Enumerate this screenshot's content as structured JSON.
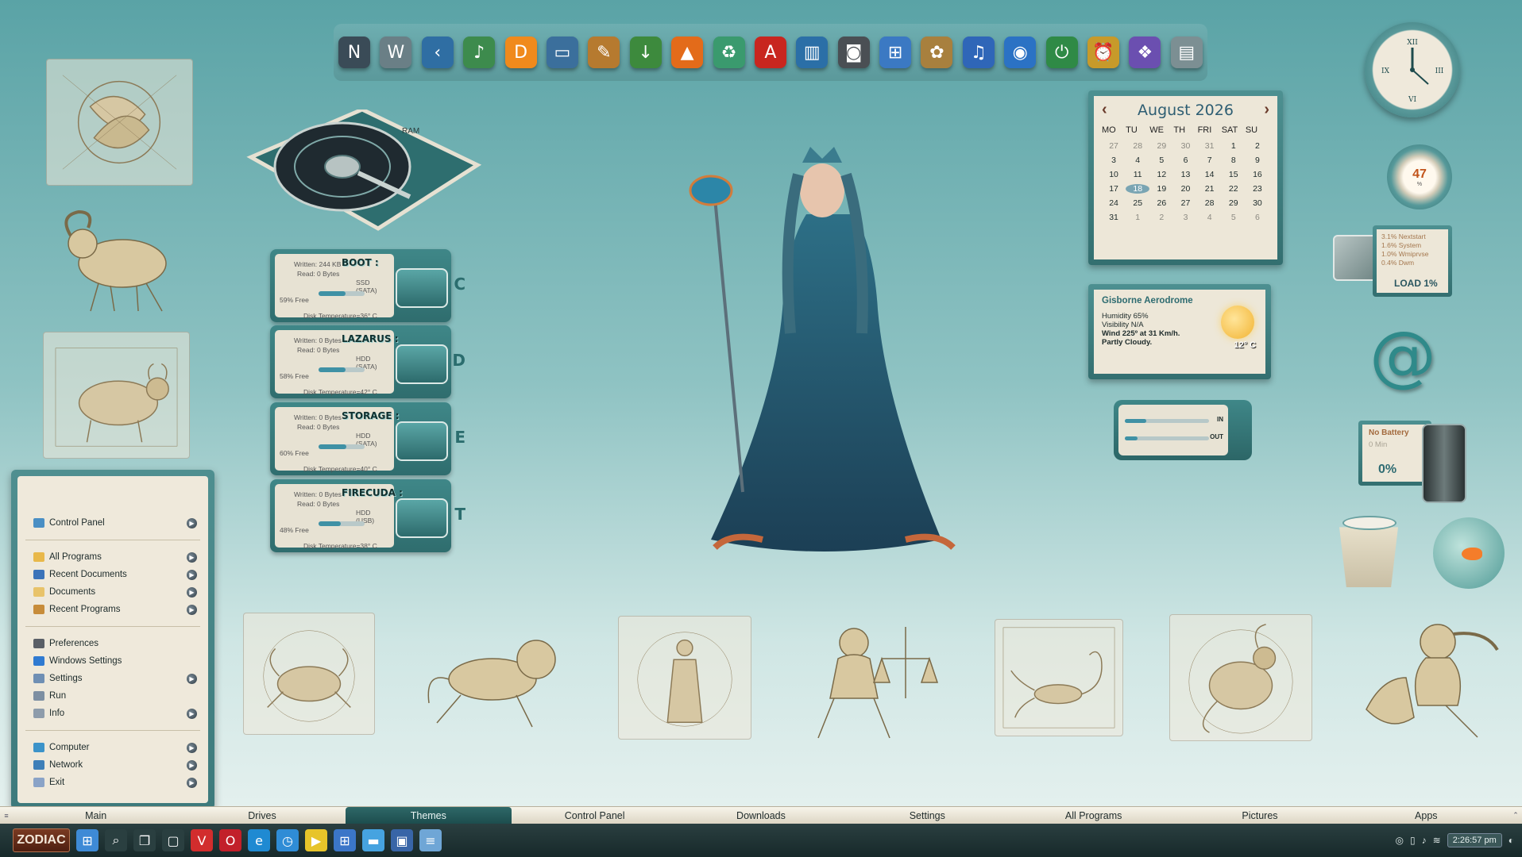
{
  "dock": {
    "icons": [
      {
        "name": "nexus-icon",
        "glyph": "N",
        "color": "#3a4b57"
      },
      {
        "name": "winstep-icon",
        "glyph": "W",
        "color": "#6a7f86"
      },
      {
        "name": "back-icon",
        "glyph": "‹",
        "color": "#2f6ea3"
      },
      {
        "name": "winamp-icon",
        "glyph": "♪",
        "color": "#3d8b4d"
      },
      {
        "name": "potplayer-icon",
        "glyph": "D",
        "color": "#f08a1c"
      },
      {
        "name": "monitor-icon",
        "glyph": "▭",
        "color": "#3b6f9c"
      },
      {
        "name": "paint-icon",
        "glyph": "✎",
        "color": "#b67a2f"
      },
      {
        "name": "download-icon",
        "glyph": "↓",
        "color": "#3d8a3d"
      },
      {
        "name": "vlc-icon",
        "glyph": "▲",
        "color": "#e36b1a"
      },
      {
        "name": "recycle-web-icon",
        "glyph": "♻",
        "color": "#3a9a6e"
      },
      {
        "name": "acrobat-icon",
        "glyph": "A",
        "color": "#c8261f"
      },
      {
        "name": "library-icon",
        "glyph": "▥",
        "color": "#2b6fa7"
      },
      {
        "name": "camera-icon",
        "glyph": "◙",
        "color": "#4a4f54"
      },
      {
        "name": "windows-icon",
        "glyph": "⊞",
        "color": "#3b79c3"
      },
      {
        "name": "palette-icon",
        "glyph": "✿",
        "color": "#a8803e"
      },
      {
        "name": "music-note-icon",
        "glyph": "♫",
        "color": "#2f66b8"
      },
      {
        "name": "volume-icon",
        "glyph": "◉",
        "color": "#2b72c4"
      },
      {
        "name": "power-icon",
        "glyph": "⏻",
        "color": "#2f8a46"
      },
      {
        "name": "alarm-clock-icon",
        "glyph": "⏰",
        "color": "#c79a2a"
      },
      {
        "name": "gallery-icon",
        "glyph": "❖",
        "color": "#6b4fb0"
      },
      {
        "name": "drive-monitor-icon",
        "glyph": "▤",
        "color": "#7c8f93"
      }
    ]
  },
  "drives": [
    {
      "name": "BOOT :",
      "written": "Written: 244 KB",
      "read": "Read: 0 Bytes",
      "type": "SSD (SATA)",
      "free_label": "59% Free",
      "free_fraction": 0.59,
      "temp": "Disk Temperature=36° C",
      "letter": "C"
    },
    {
      "name": "LAZARUS :",
      "written": "Written: 0 Bytes",
      "read": "Read: 0 Bytes",
      "type": "HDD (SATA)",
      "free_label": "58% Free",
      "free_fraction": 0.58,
      "temp": "Disk Temperature=42° C",
      "letter": "D"
    },
    {
      "name": "STORAGE :",
      "written": "Written: 0 Bytes",
      "read": "Read: 0 Bytes",
      "type": "HDD (SATA)",
      "free_label": "60% Free",
      "free_fraction": 0.6,
      "temp": "Disk Temperature=40° C",
      "letter": "E"
    },
    {
      "name": "FIRECUDA :",
      "written": "Written: 0 Bytes",
      "read": "Read: 0 Bytes",
      "type": "HDD (USB)",
      "free_label": "48% Free",
      "free_fraction": 0.48,
      "temp": "Disk Temperature=38° C",
      "letter": "T"
    }
  ],
  "hdd": {
    "label": "RAM"
  },
  "start_menu": {
    "groups": [
      [
        {
          "label": "Control Panel",
          "icon": "control-panel-icon",
          "arrow": true,
          "color": "#4a8fc4"
        }
      ],
      [
        {
          "label": "All Programs",
          "icon": "folder-icon",
          "arrow": true,
          "color": "#e8b84a"
        },
        {
          "label": "Recent Documents",
          "icon": "document-icon",
          "arrow": true,
          "color": "#3b73b9"
        },
        {
          "label": "Documents",
          "icon": "documents-icon",
          "arrow": true,
          "color": "#e8c36a"
        },
        {
          "label": "Recent Programs",
          "icon": "programs-icon",
          "arrow": true,
          "color": "#c78c3a"
        }
      ],
      [
        {
          "label": "Preferences",
          "icon": "gear-icon",
          "arrow": false,
          "color": "#5a5f66"
        },
        {
          "label": "Windows Settings",
          "icon": "windows-icon",
          "arrow": false,
          "color": "#2f7ad1"
        },
        {
          "label": "Settings",
          "icon": "settings-icon",
          "arrow": true,
          "color": "#6f8fb4"
        },
        {
          "label": "Run",
          "icon": "run-icon",
          "arrow": false,
          "color": "#7d8fa2"
        },
        {
          "label": "Info",
          "icon": "info-icon",
          "arrow": true,
          "color": "#8e9cab"
        }
      ],
      [
        {
          "label": "Computer",
          "icon": "computer-icon",
          "arrow": true,
          "color": "#3c93c9"
        },
        {
          "label": "Network",
          "icon": "network-icon",
          "arrow": true,
          "color": "#3e7fb8"
        },
        {
          "label": "Exit",
          "icon": "exit-icon",
          "arrow": true,
          "color": "#8aa3c7"
        }
      ]
    ]
  },
  "calendar": {
    "month": "August 2026",
    "prev": "‹",
    "next": "›",
    "dow": [
      "MO",
      "TU",
      "WE",
      "TH",
      "FRI",
      "SAT",
      "SU"
    ],
    "weeks": [
      [
        {
          "d": "27",
          "m": 1
        },
        {
          "d": "28",
          "m": 1
        },
        {
          "d": "29",
          "m": 1
        },
        {
          "d": "30",
          "m": 1
        },
        {
          "d": "31",
          "m": 1
        },
        {
          "d": "1"
        },
        {
          "d": "2"
        }
      ],
      [
        {
          "d": "3"
        },
        {
          "d": "4"
        },
        {
          "d": "5"
        },
        {
          "d": "6"
        },
        {
          "d": "7"
        },
        {
          "d": "8"
        },
        {
          "d": "9"
        }
      ],
      [
        {
          "d": "10"
        },
        {
          "d": "11"
        },
        {
          "d": "12"
        },
        {
          "d": "13"
        },
        {
          "d": "14"
        },
        {
          "d": "15"
        },
        {
          "d": "16"
        }
      ],
      [
        {
          "d": "17"
        },
        {
          "d": "18",
          "t": 1
        },
        {
          "d": "19"
        },
        {
          "d": "20"
        },
        {
          "d": "21"
        },
        {
          "d": "22"
        },
        {
          "d": "23"
        }
      ],
      [
        {
          "d": "24"
        },
        {
          "d": "25"
        },
        {
          "d": "26"
        },
        {
          "d": "27"
        },
        {
          "d": "28"
        },
        {
          "d": "29"
        },
        {
          "d": "30"
        }
      ],
      [
        {
          "d": "31"
        },
        {
          "d": "1",
          "m": 1
        },
        {
          "d": "2",
          "m": 1
        },
        {
          "d": "3",
          "m": 1
        },
        {
          "d": "4",
          "m": 1
        },
        {
          "d": "5",
          "m": 1
        },
        {
          "d": "6",
          "m": 1
        }
      ]
    ]
  },
  "weather": {
    "location": "Gisborne Aerodrome",
    "humidity": "Humidity 65%",
    "visibility": "Visibility N/A",
    "wind": "Wind 225º at 31 Km/h.",
    "condition": "Partly Cloudy.",
    "temp": "12° C"
  },
  "netmeter": {
    "in_label": "IN",
    "out_label": "OUT",
    "in_fraction": 0.25,
    "out_fraction": 0.15
  },
  "cpu": {
    "value": "47",
    "unit": "%"
  },
  "load": {
    "lines": [
      "3.1% Nextstart",
      "1.6% System",
      "1.0% Wmiprvse",
      "0.4% Dwm"
    ],
    "label": "LOAD 1%"
  },
  "battery": {
    "title": "No Battery",
    "time": "0 Min",
    "percent": "0%"
  },
  "tabs": {
    "items": [
      "Main",
      "Drives",
      "Themes",
      "Control Panel",
      "Downloads",
      "Settings",
      "All Programs",
      "Pictures",
      "Apps"
    ],
    "active": "Themes"
  },
  "taskbar": {
    "start_label": "ZODIAC",
    "icons": [
      {
        "name": "windows-start-icon",
        "glyph": "⊞",
        "color": "#3e8ad6"
      },
      {
        "name": "search-icon",
        "glyph": "⌕",
        "color": "#2a3f40"
      },
      {
        "name": "task-view-icon",
        "glyph": "❐",
        "color": "#2a3f40"
      },
      {
        "name": "chat-icon",
        "glyph": "▢",
        "color": "#2a3f40"
      },
      {
        "name": "vivaldi-icon",
        "glyph": "V",
        "color": "#d22d2d"
      },
      {
        "name": "opera-icon",
        "glyph": "O",
        "color": "#c2202a"
      },
      {
        "name": "edge-icon",
        "glyph": "e",
        "color": "#1f8ad2"
      },
      {
        "name": "speed-icon",
        "glyph": "◷",
        "color": "#2f8cd6"
      },
      {
        "name": "player-icon",
        "glyph": "▶",
        "color": "#e7c42a"
      },
      {
        "name": "windows11-icon",
        "glyph": "⊞",
        "color": "#3b76c8"
      },
      {
        "name": "explorer-icon",
        "glyph": "▬",
        "color": "#46a3e0"
      },
      {
        "name": "remote-desktop-icon",
        "glyph": "▣",
        "color": "#3865a7"
      },
      {
        "name": "notepad-icon",
        "glyph": "≡",
        "color": "#6fa6d6"
      }
    ],
    "clock": "2:26:57 pm"
  }
}
